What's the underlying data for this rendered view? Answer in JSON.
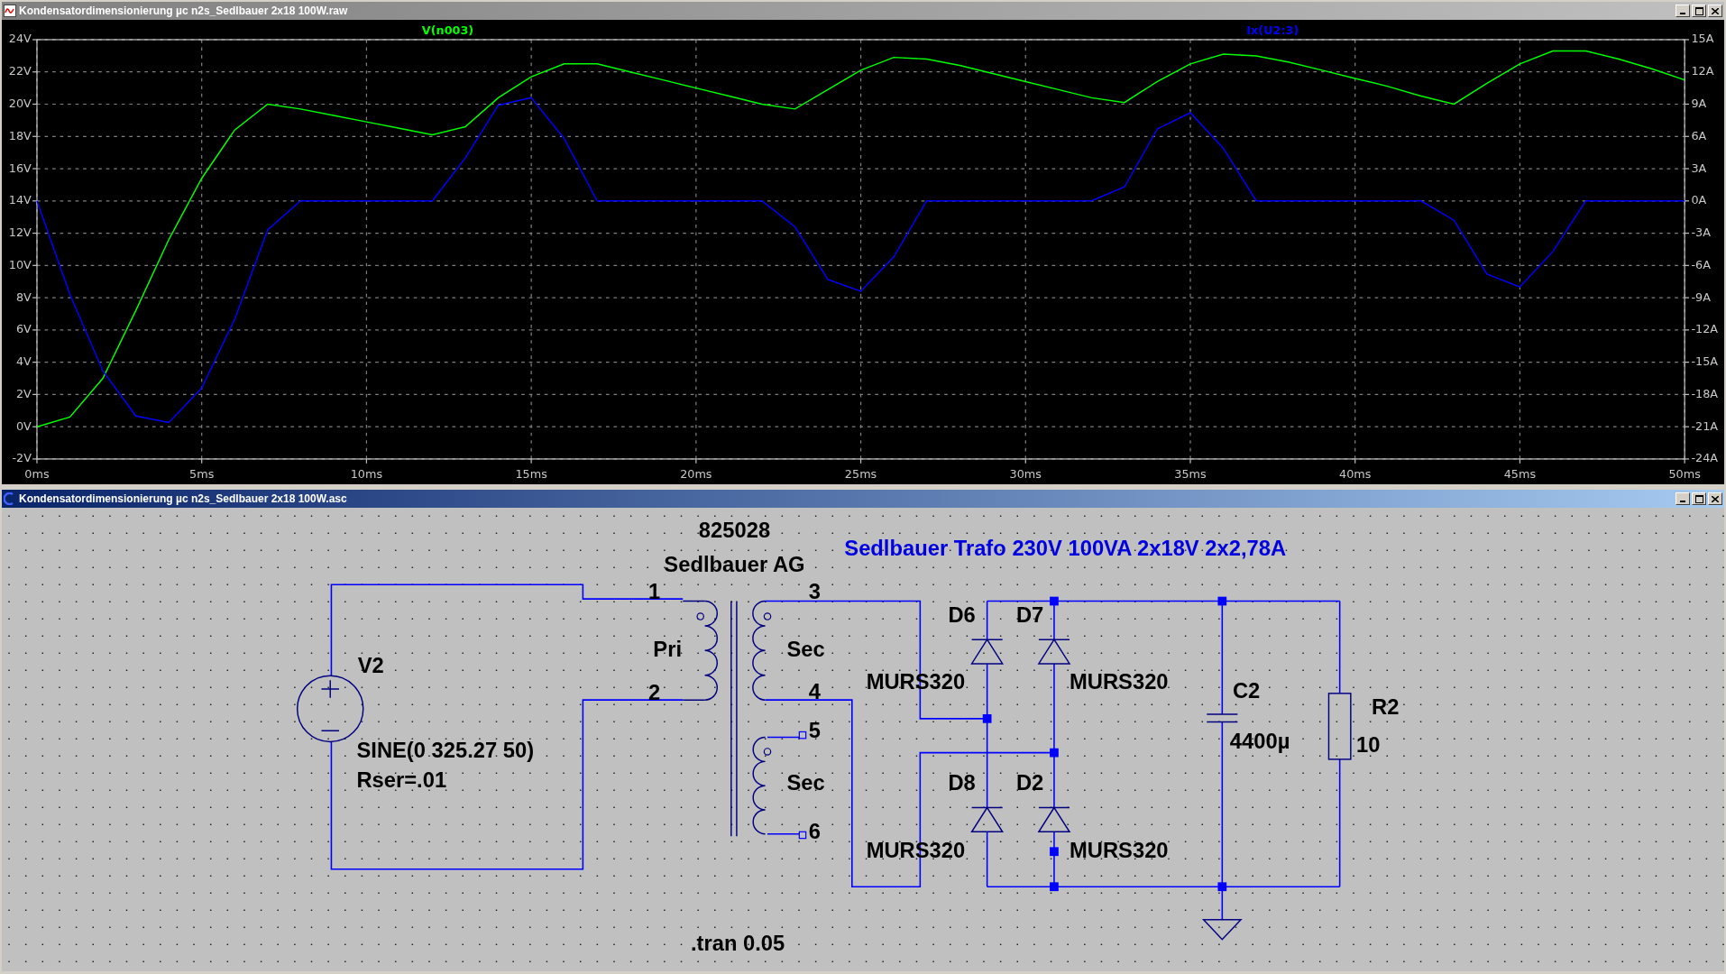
{
  "windows": [
    {
      "kind": "waveform",
      "title": "Kondensatordimensionierung µc n2s_Sedlbauer 2x18 100W.raw",
      "active": false,
      "chart_data": {
        "type": "line",
        "x": [
          0,
          1,
          2,
          3,
          4,
          5,
          6,
          7,
          8,
          9,
          10,
          11,
          12,
          13,
          14,
          15,
          16,
          17,
          18,
          19,
          20,
          21,
          22,
          23,
          24,
          25,
          26,
          27,
          28,
          29,
          30,
          31,
          32,
          33,
          34,
          35,
          36,
          37,
          38,
          39,
          40,
          41,
          42,
          43,
          44,
          45,
          46,
          47,
          48,
          49,
          50
        ],
        "series": [
          {
            "name": "V(n003)",
            "color": "#00ff00",
            "axis": "y",
            "values": [
              0,
              0.6,
              3.0,
              7.2,
              11.6,
              15.4,
              18.4,
              20.0,
              19.7,
              19.3,
              18.9,
              18.5,
              18.1,
              18.6,
              20.4,
              21.7,
              22.5,
              22.5,
              22.0,
              21.5,
              21.0,
              20.5,
              20.0,
              19.7,
              20.9,
              22.1,
              22.9,
              22.8,
              22.4,
              21.9,
              21.4,
              20.9,
              20.4,
              20.1,
              21.4,
              22.5,
              23.1,
              23.0,
              22.6,
              22.1,
              21.6,
              21.1,
              20.5,
              20.0,
              21.3,
              22.5,
              23.3,
              23.3,
              22.8,
              22.2,
              21.5
            ]
          },
          {
            "name": "Ix(U2:3)",
            "color": "#0000ff",
            "axis": "y2",
            "values": [
              0,
              -8.7,
              -15.8,
              -20.0,
              -20.6,
              -17.4,
              -11.0,
              -2.7,
              0,
              0,
              0,
              0,
              0,
              4.0,
              8.9,
              9.6,
              5.8,
              0,
              0,
              0,
              0,
              0,
              0,
              -2.4,
              -7.3,
              -8.4,
              -5.2,
              0,
              0,
              0,
              0,
              0,
              0,
              1.3,
              6.7,
              8.2,
              4.9,
              0,
              0,
              0,
              0,
              0,
              0,
              -1.8,
              -6.8,
              -8.0,
              -4.7,
              0,
              0,
              0,
              0
            ]
          }
        ],
        "grid": true,
        "xlim": [
          0,
          50
        ],
        "xticks": [
          {
            "value": 0,
            "label": "0ms"
          },
          {
            "value": 5,
            "label": "5ms"
          },
          {
            "value": 10,
            "label": "10ms"
          },
          {
            "value": 15,
            "label": "15ms"
          },
          {
            "value": 20,
            "label": "20ms"
          },
          {
            "value": 25,
            "label": "25ms"
          },
          {
            "value": 30,
            "label": "30ms"
          },
          {
            "value": 35,
            "label": "35ms"
          },
          {
            "value": 40,
            "label": "40ms"
          },
          {
            "value": 45,
            "label": "45ms"
          },
          {
            "value": 50,
            "label": "50ms"
          }
        ],
        "ylim": [
          -2,
          24
        ],
        "yticks": [
          {
            "value": -2,
            "label": "-2V"
          },
          {
            "value": 0,
            "label": "0V"
          },
          {
            "value": 2,
            "label": "2V"
          },
          {
            "value": 4,
            "label": "4V"
          },
          {
            "value": 6,
            "label": "6V"
          },
          {
            "value": 8,
            "label": "8V"
          },
          {
            "value": 10,
            "label": "10V"
          },
          {
            "value": 12,
            "label": "12V"
          },
          {
            "value": 14,
            "label": "14V"
          },
          {
            "value": 16,
            "label": "16V"
          },
          {
            "value": 18,
            "label": "18V"
          },
          {
            "value": 20,
            "label": "20V"
          },
          {
            "value": 22,
            "label": "22V"
          },
          {
            "value": 24,
            "label": "24V"
          }
        ],
        "y2lim": [
          -24,
          15
        ],
        "y2ticks": [
          {
            "value": -24,
            "label": "-24A"
          },
          {
            "value": -21,
            "label": "-21A"
          },
          {
            "value": -18,
            "label": "-18A"
          },
          {
            "value": -15,
            "label": "-15A"
          },
          {
            "value": -12,
            "label": "-12A"
          },
          {
            "value": -9,
            "label": "-9A"
          },
          {
            "value": -6,
            "label": "-6A"
          },
          {
            "value": -3,
            "label": "-3A"
          },
          {
            "value": 0,
            "label": "0A"
          },
          {
            "value": 3,
            "label": "3A"
          },
          {
            "value": 6,
            "label": "6A"
          },
          {
            "value": 9,
            "label": "9A"
          },
          {
            "value": 12,
            "label": "12A"
          },
          {
            "value": 15,
            "label": "15A"
          }
        ]
      }
    },
    {
      "kind": "schematic",
      "title": "Kondensatordimensionierung µc n2s_Sedlbauer 2x18 100W.asc",
      "active": true,
      "comment": "Sedlbauer Trafo 230V 100VA 2x18V 2x2,78A",
      "transformer": {
        "part_number": "825028",
        "manufacturer": "Sedlbauer AG",
        "windings": [
          "Pri",
          "Sec",
          "Sec"
        ],
        "pins": [
          "1",
          "2",
          "3",
          "4",
          "5",
          "6"
        ]
      },
      "components": [
        {
          "name": "V2",
          "values": [
            "SINE(0 325.27 50)",
            "Rser=.01"
          ]
        },
        {
          "name": "D6",
          "values": [
            "MURS320"
          ]
        },
        {
          "name": "D7",
          "values": [
            "MURS320"
          ]
        },
        {
          "name": "D8",
          "values": [
            "MURS320"
          ]
        },
        {
          "name": "D2",
          "values": [
            "MURS320"
          ]
        },
        {
          "name": "C2",
          "values": [
            "4400µ"
          ]
        },
        {
          "name": "R2",
          "values": [
            "10"
          ]
        }
      ],
      "directive": ".tran 0.05"
    }
  ]
}
